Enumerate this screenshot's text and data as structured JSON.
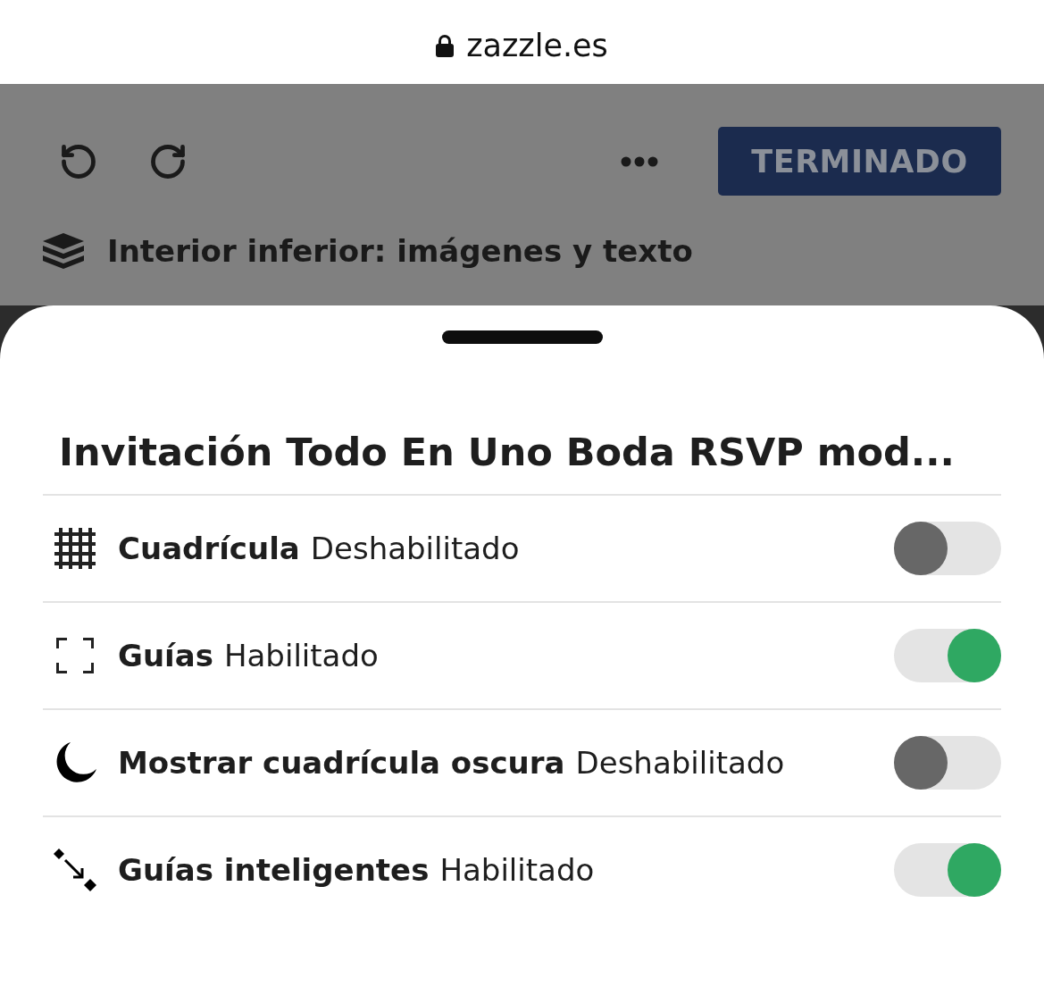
{
  "address_bar": {
    "url": "zazzle.es"
  },
  "toolbar": {
    "done_button": "TERMINADO",
    "section_title": "Interior inferior: imágenes y texto"
  },
  "sheet": {
    "title": "Invitación Todo En Uno Boda RSVP mod...",
    "settings": [
      {
        "kind": "grid",
        "label": "Cuadrícula",
        "status": "Deshabilitado",
        "on": false
      },
      {
        "kind": "guides",
        "label": "Guías",
        "status": "Habilitado",
        "on": true
      },
      {
        "kind": "dark_grid",
        "label": "Mostrar cuadrícula oscura",
        "status": "Deshabilitado",
        "on": false
      },
      {
        "kind": "smart_guides",
        "label": "Guías inteligentes",
        "status": "Habilitado",
        "on": true
      }
    ]
  }
}
